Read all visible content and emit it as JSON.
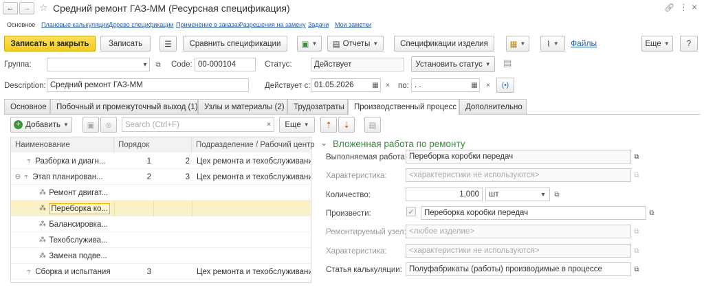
{
  "window": {
    "title": "Средний ремонт ГАЗ-ММ (Ресурсная спецификация)"
  },
  "nav_tabs": [
    {
      "label": "Основное",
      "active": true
    },
    {
      "label": "Плановые калькуляции"
    },
    {
      "label": "Дерево спецификации"
    },
    {
      "label": "Применение в заказах"
    },
    {
      "label": "Разрешения на замену"
    },
    {
      "label": "Задачи"
    },
    {
      "label": "Мои заметки"
    }
  ],
  "toolbar": {
    "save_close": "Записать и закрыть",
    "save": "Записать",
    "compare": "Сравнить спецификации",
    "reports": "Отчеты",
    "item_specs": "Спецификации изделия",
    "files": "Файлы",
    "more": "Еще",
    "help": "?"
  },
  "header_fields": {
    "group_label": "Группа:",
    "group_value": "",
    "code_label": "Code:",
    "code_value": "00-000104",
    "status_label": "Статус:",
    "status_value": "Действует",
    "set_status": "Установить статус",
    "description_label": "Description:",
    "description_value": "Средний ремонт ГАЗ-ММ",
    "valid_from_label": "Действует с:",
    "valid_from_value": "01.05.2026",
    "valid_to_label": "по:",
    "valid_to_value": " .  ."
  },
  "tabs": [
    {
      "label": "Основное"
    },
    {
      "label": "Побочный и промежуточный выход (1)"
    },
    {
      "label": "Узлы и материалы (2)"
    },
    {
      "label": "Трудозатраты"
    },
    {
      "label": "Производственный процесс",
      "active": true
    },
    {
      "label": "Дополнительно"
    }
  ],
  "list_toolbar": {
    "add": "Добавить",
    "search_placeholder": "Search (Ctrl+F)",
    "more": "Еще"
  },
  "table": {
    "columns": [
      "Наименование",
      "Порядок",
      "Подразделение / Рабочий центр"
    ],
    "rows": [
      {
        "name": "Разборка и диагн...",
        "order": "1",
        "order2": "2",
        "dept": "Цех ремонта и техобслуживания",
        "level": 0
      },
      {
        "name": "Этап планирован...",
        "order": "2",
        "order2": "3",
        "dept": "Цех ремонта и техобслуживания",
        "level": 0,
        "expanded": true
      },
      {
        "name": "Ремонт двигат...",
        "order": "",
        "order2": "",
        "dept": "",
        "level": 1
      },
      {
        "name": "Переборка ко...",
        "order": "",
        "order2": "",
        "dept": "",
        "level": 1,
        "selected": true
      },
      {
        "name": "Балансировка...",
        "order": "",
        "order2": "",
        "dept": "",
        "level": 1
      },
      {
        "name": "Техобслужива...",
        "order": "",
        "order2": "",
        "dept": "",
        "level": 1
      },
      {
        "name": "Замена подве...",
        "order": "",
        "order2": "",
        "dept": "",
        "level": 1
      },
      {
        "name": "Сборка и испытания",
        "order": "3",
        "order2": "",
        "dept": "Цех ремонта и техобслуживания",
        "level": 0
      }
    ]
  },
  "detail": {
    "section_title": "Вложенная работа по ремонту",
    "work_label": "Выполняемая работа:",
    "work_value": "Переборка коробки передач",
    "char1_label": "Характеристика:",
    "char1_placeholder": "<характеристики не используются>",
    "qty_label": "Количество:",
    "qty_value": "1,000",
    "unit_value": "шт",
    "produce_label": "Произвести:",
    "produce_value": "Переборка коробки передач",
    "produce_checked": true,
    "node_label": "Ремонтируемый узел:",
    "node_placeholder": "<любое изделие>",
    "char2_label": "Характеристика:",
    "char2_placeholder": "<характеристики не используются>",
    "costing_label": "Статья калькуляции:",
    "costing_value": "Полуфабрикаты (работы) производимые в процессе"
  },
  "colors": {
    "accent_yellow": "#f5cf2b",
    "link_blue": "#2a5fa8",
    "section_green": "#3a8a3a",
    "selected_row": "#fbf1c6"
  }
}
